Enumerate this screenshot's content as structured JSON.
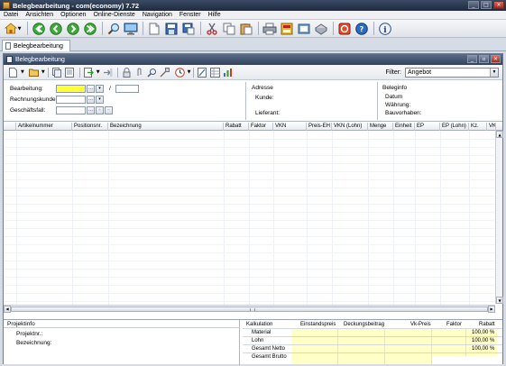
{
  "app": {
    "title": "Belegbearbeitung - com(economy) 7.72"
  },
  "menu": [
    "Datei",
    "Ansichten",
    "Optionen",
    "Online-Dienste",
    "Navigation",
    "Fenster",
    "Hilfe"
  ],
  "toolbar_icons": [
    "home-icon",
    "back-icon",
    "forward-icon",
    "next-icon",
    "refresh-icon",
    "search-icon",
    "monitor-icon",
    "new-document-icon",
    "save-icon",
    "save-as-icon",
    "cut-icon",
    "copy-icon",
    "paste-icon",
    "print-icon",
    "preview-icon",
    "mail-icon",
    "fax-icon",
    "stop-icon",
    "help-book-icon",
    "help-icon",
    "info-icon"
  ],
  "tab": {
    "label": "Belegbearbeitung"
  },
  "window": {
    "title": "Belegbearbeitung"
  },
  "filter": {
    "label": "Filter:",
    "value": "Angebot"
  },
  "form": {
    "bearbeitung_label": "Bearbeitung:",
    "rechnungskunde_label": "Rechnungskunde:",
    "geschaeftsfall_label": "Geschäftsfall:",
    "slash": "/",
    "adresse_label": "Adresse",
    "kunde_label": "Kunde:",
    "lieferant_label": "Lieferant:",
    "beleginfo_label": "Beleginfo",
    "datum_label": "Datum",
    "waehrung_label": "Währung:",
    "bauvorhaben_label": "Bauvorhaben:"
  },
  "grid": {
    "columns": [
      "Artikelnummer",
      "Positionsnr.",
      "Bezeichnung",
      "Rabatt",
      "Faktor",
      "VKN",
      "Preis-EH",
      "VKN (Lohn)",
      "Menge",
      "Einheit",
      "EP",
      "EP (Lohn)",
      "Kz.",
      "VK"
    ]
  },
  "projekt": {
    "header": "Projektinfo",
    "projektnr_label": "Projektnr.:",
    "bezeichnung_label": "Bezeichnung:"
  },
  "kalkulation": {
    "header": "Kalkulation",
    "columns": [
      "Einstandspreis",
      "Deckungsbeitrag",
      "Vk-Preis",
      "Faktor",
      "Rabatt"
    ],
    "rows": [
      {
        "label": "Material",
        "rabatt": "100,00 %"
      },
      {
        "label": "Lohn",
        "rabatt": "100,00 %"
      },
      {
        "label": "Gesamt Netto",
        "rabatt": "100,00 %"
      },
      {
        "label": "Gesamt Brutto",
        "rabatt": ""
      }
    ]
  },
  "colors": {
    "required_field": "#ffff33",
    "calc_cell": "#ffffc6",
    "title_bar": "#2a3650"
  }
}
